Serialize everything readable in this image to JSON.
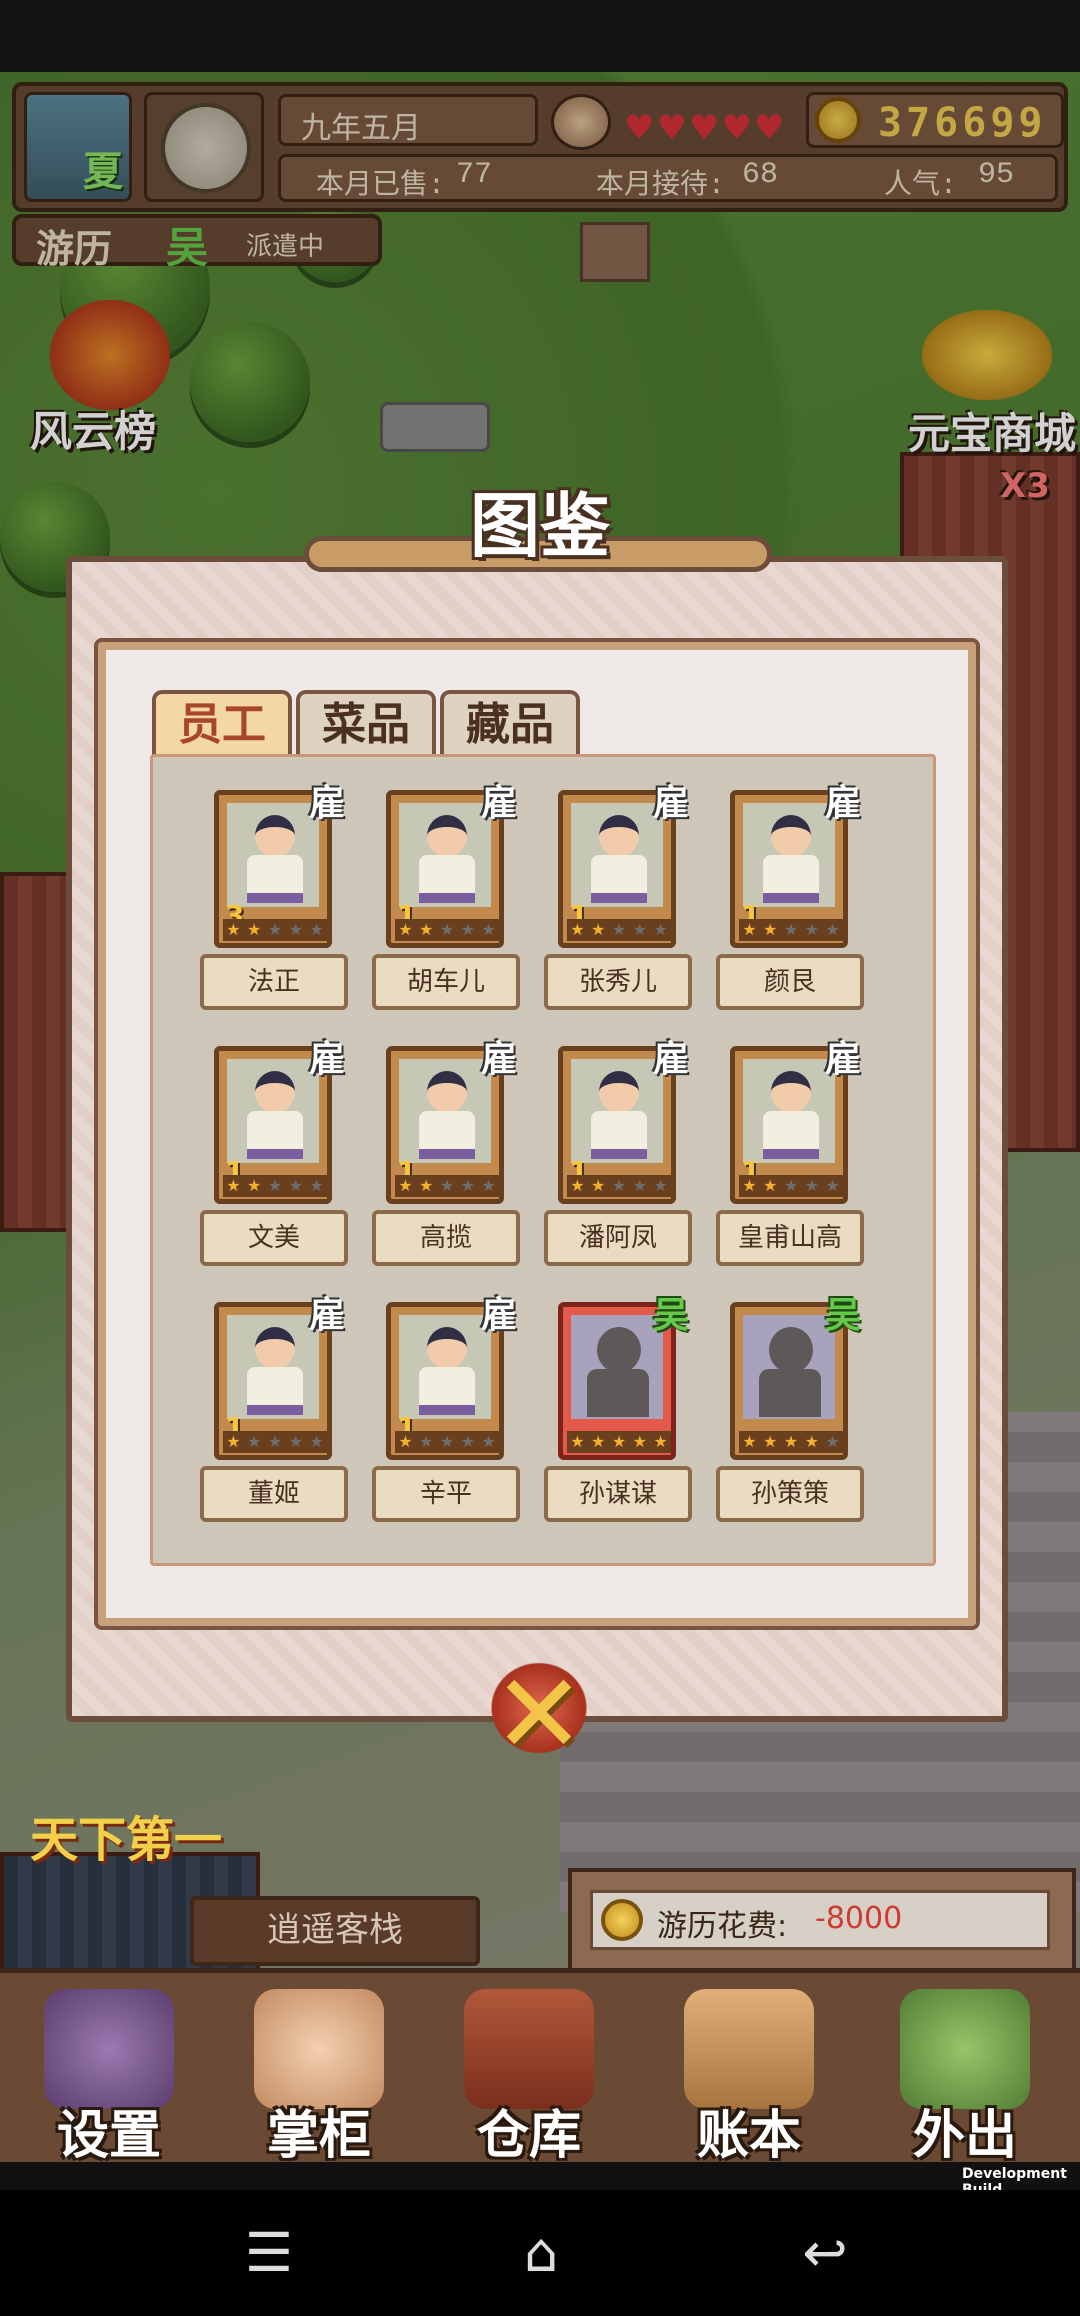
{
  "hud": {
    "season": "夏",
    "date": "九年五月",
    "hearts": "♥♥♥♥♥",
    "coins": "376699",
    "sold_label": "本月已售:",
    "sold_value": "77",
    "served_label": "本月接待:",
    "served_value": "68",
    "popularity_label": "人气:",
    "popularity_value": "95"
  },
  "travel": {
    "label": "游历",
    "status_icon": "吴",
    "status": "派遣中"
  },
  "side": {
    "rank_label": "风云榜",
    "shop_label": "元宝商城",
    "speed": "X3"
  },
  "modal": {
    "title": "图鉴",
    "tabs": [
      {
        "label": "员工",
        "active": true
      },
      {
        "label": "菜品",
        "active": false
      },
      {
        "label": "藏品",
        "active": false
      }
    ],
    "cards": [
      {
        "name": "法正",
        "level": "3",
        "stars": 2,
        "badge": "雇",
        "locked": false
      },
      {
        "name": "胡车儿",
        "level": "1",
        "stars": 2,
        "badge": "雇",
        "locked": false
      },
      {
        "name": "张秀儿",
        "level": "1",
        "stars": 2,
        "badge": "雇",
        "locked": false
      },
      {
        "name": "颜艮",
        "level": "1",
        "stars": 2,
        "badge": "雇",
        "locked": false
      },
      {
        "name": "文美",
        "level": "1",
        "stars": 2,
        "badge": "雇",
        "locked": false
      },
      {
        "name": "高揽",
        "level": "1",
        "stars": 2,
        "badge": "雇",
        "locked": false
      },
      {
        "name": "潘阿凤",
        "level": "1",
        "stars": 2,
        "badge": "雇",
        "locked": false
      },
      {
        "name": "皇甫山高",
        "level": "1",
        "stars": 2,
        "badge": "雇",
        "locked": false
      },
      {
        "name": "董姬",
        "level": "1",
        "stars": 1,
        "badge": "雇",
        "locked": false
      },
      {
        "name": "辛平",
        "level": "1",
        "stars": 1,
        "badge": "雇",
        "locked": false
      },
      {
        "name": "孙谋谋",
        "level": "",
        "stars": 5,
        "badge": "吴",
        "locked": true
      },
      {
        "name": "孙策策",
        "level": "",
        "stars": 4,
        "badge": "吴",
        "locked": true
      }
    ],
    "close_glyph": "✕"
  },
  "bottom": {
    "rank_badge": "天下第一",
    "inn_name": "逍遥客栈",
    "cost_label": "游历花费:",
    "cost_value": "-8000",
    "menu": [
      {
        "label": "设置",
        "icon": "yin-yang-gear-icon",
        "color": "#5a3c6e"
      },
      {
        "label": "掌柜",
        "icon": "innkeeper-face-icon",
        "color": "#e3b38a"
      },
      {
        "label": "仓库",
        "icon": "storage-chest-icon",
        "color": "#9a4a2e"
      },
      {
        "label": "账本",
        "icon": "scroll-ledger-icon",
        "color": "#c89860"
      },
      {
        "label": "外出",
        "icon": "travel-bundle-icon",
        "color": "#5f8f3c"
      }
    ]
  },
  "footer": {
    "dev_build": "Development Build"
  },
  "navbar": {
    "menu": "☰",
    "home": "⌂",
    "back": "↩"
  }
}
